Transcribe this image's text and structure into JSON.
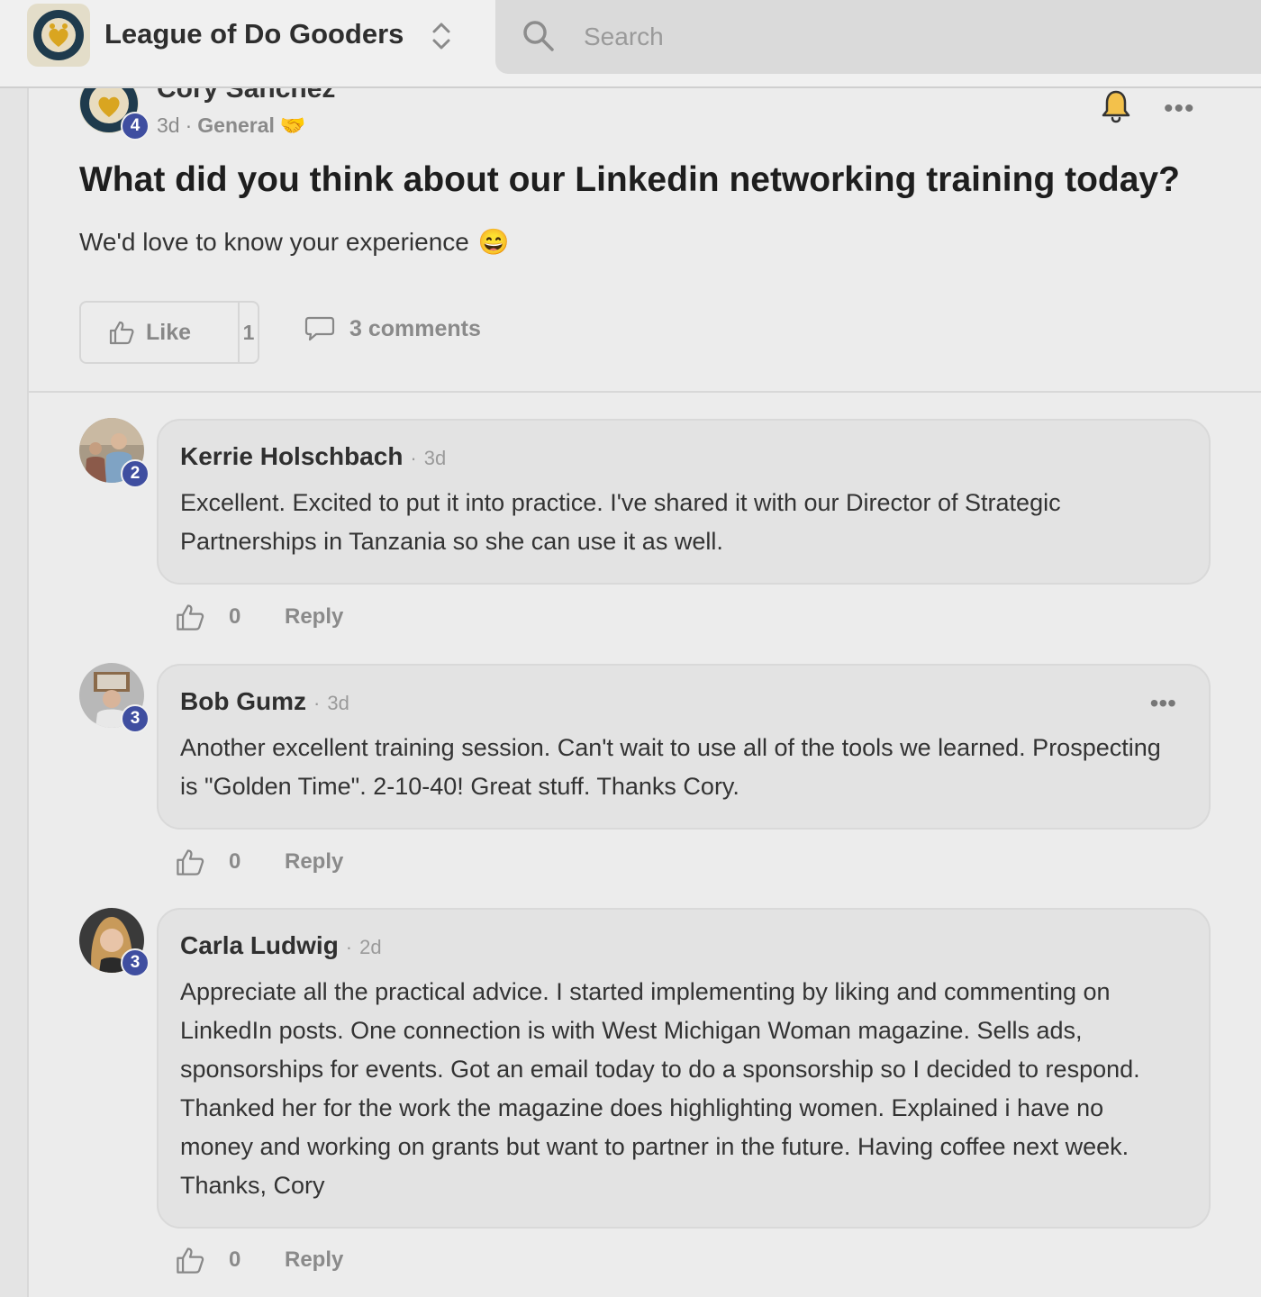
{
  "header": {
    "community_name": "League of Do Gooders",
    "logo_icon": "league-logo",
    "search_placeholder": "Search"
  },
  "post": {
    "author": "Cory Sanchez",
    "author_level": "4",
    "age": "3d",
    "category": "General",
    "category_emoji": "🤝",
    "title": "What did you think about our Linkedin networking training today?",
    "body": "We'd love to know your experience",
    "body_emoji": "😄",
    "like_label": "Like",
    "like_count": "1",
    "comments_label": "3 comments"
  },
  "comments": [
    {
      "author": "Kerrie Holschbach",
      "level": "2",
      "age": "3d",
      "text": "Excellent. Excited to put it into practice. I've shared it with our Director of Strategic Partnerships in Tanzania so she can use it as well.",
      "likes": "0",
      "reply_label": "Reply"
    },
    {
      "author": "Bob Gumz",
      "level": "3",
      "age": "3d",
      "text": "Another excellent training session. Can't wait to use all of the tools we learned. Prospecting is \"Golden Time\". 2-10-40! Great stuff. Thanks Cory.",
      "likes": "0",
      "reply_label": "Reply"
    },
    {
      "author": "Carla Ludwig",
      "level": "3",
      "age": "2d",
      "text": "Appreciate all the practical advice. I started implementing by liking and commenting on LinkedIn posts. One connection is with West Michigan Woman magazine. Sells ads, sponsorships for events. Got an email today to do a sponsorship so I decided to respond. Thanked her for the work the magazine does highlighting women. Explained i have no money and working on grants but want to partner in the future. Having coffee next week. Thanks, Cory",
      "likes": "0",
      "reply_label": "Reply"
    }
  ],
  "colors": {
    "badge": "#3f4ea0",
    "logo_navy": "#1f3b4d",
    "logo_gold": "#d9a520"
  }
}
